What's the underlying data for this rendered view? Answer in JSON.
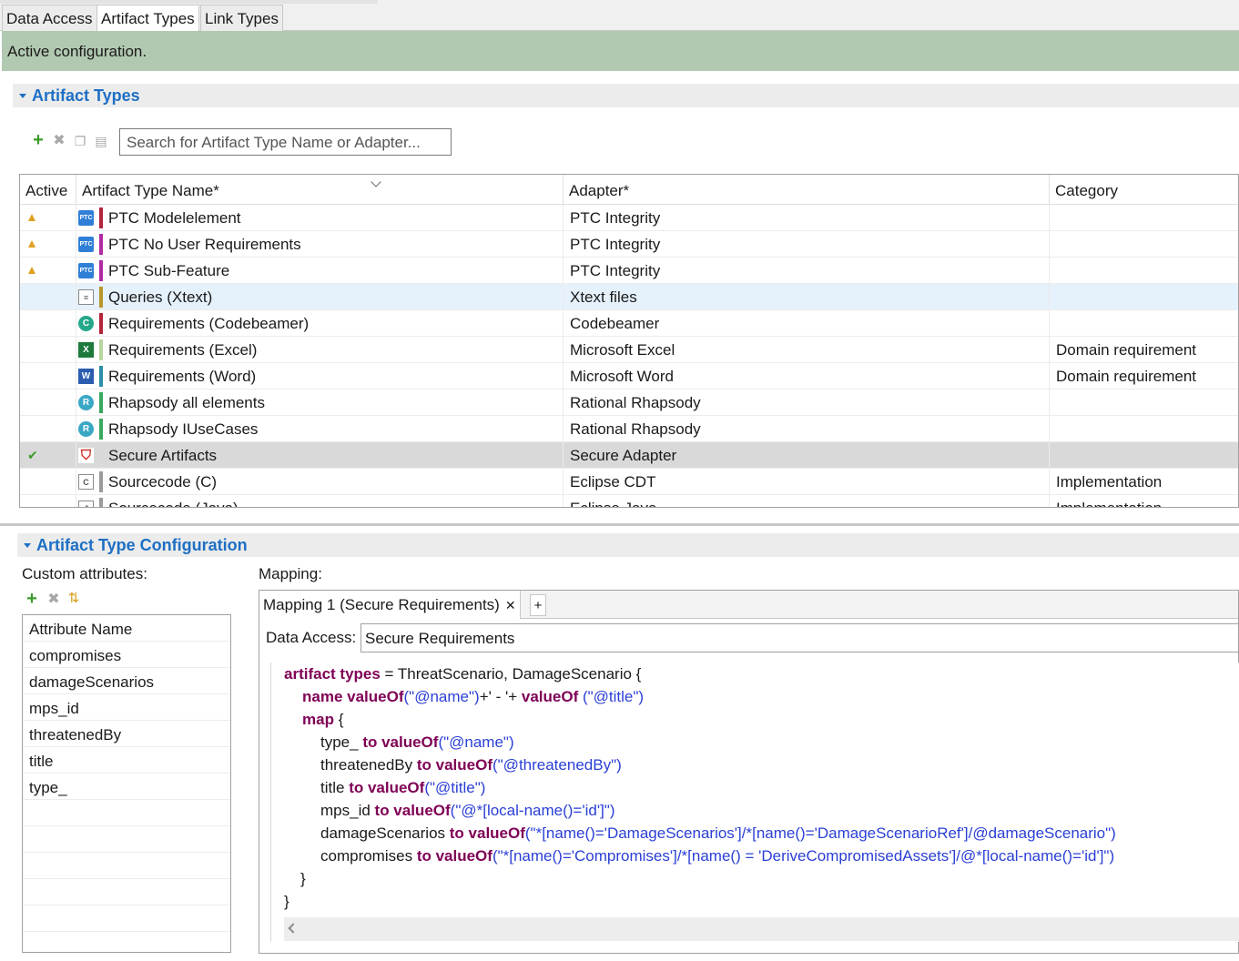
{
  "tabs": [
    {
      "label": "Data Access",
      "active": false
    },
    {
      "label": "Artifact Types",
      "active": true
    },
    {
      "label": "Link Types",
      "active": false
    }
  ],
  "status": {
    "text": "Active configuration."
  },
  "artifact_types_section": {
    "title": "Artifact Types",
    "toolbar": {
      "add_icon": "add-icon",
      "delete_icon": "delete-icon",
      "copy_icon": "copy-icon",
      "paste_icon": "paste-icon"
    },
    "search": {
      "placeholder": "Search for Artifact Type Name or Adapter..."
    },
    "columns": [
      "Active",
      "Artifact Type Name*",
      "Adapter*",
      "Category"
    ],
    "rows": [
      {
        "active": "warning",
        "icon": "ptc-icon",
        "color": "#b3243a",
        "name": "PTC Modelelement",
        "adapter": "PTC Integrity",
        "category": ""
      },
      {
        "active": "warning",
        "icon": "ptc-icon",
        "color": "#b02aa0",
        "name": "PTC No User Requirements",
        "adapter": "PTC Integrity",
        "category": ""
      },
      {
        "active": "warning",
        "icon": "ptc-icon",
        "color": "#b02aa0",
        "name": "PTC Sub-Feature",
        "adapter": "PTC Integrity",
        "category": ""
      },
      {
        "active": "",
        "icon": "xtext-file-icon",
        "color": "#b8952a",
        "name": "Queries (Xtext)",
        "adapter": "Xtext files",
        "category": ""
      },
      {
        "active": "",
        "icon": "codebeamer-icon",
        "color": "#b3243a",
        "name": "Requirements (Codebeamer)",
        "adapter": "Codebeamer",
        "category": ""
      },
      {
        "active": "",
        "icon": "excel-icon",
        "color": "#b9d6a0",
        "name": "Requirements (Excel)",
        "adapter": "Microsoft Excel",
        "category": "Domain requirement"
      },
      {
        "active": "",
        "icon": "word-icon",
        "color": "#2a8fa6",
        "name": "Requirements (Word)",
        "adapter": "Microsoft Word",
        "category": "Domain requirement"
      },
      {
        "active": "",
        "icon": "rhapsody-icon",
        "color": "#3aa860",
        "name": "Rhapsody all elements",
        "adapter": "Rational Rhapsody",
        "category": ""
      },
      {
        "active": "",
        "icon": "rhapsody-icon",
        "color": "#3aa860",
        "name": "Rhapsody IUseCases",
        "adapter": "Rational Rhapsody",
        "category": ""
      },
      {
        "active": "check",
        "icon": "shield-icon",
        "color": "",
        "name": "Secure Artifacts",
        "adapter": "Secure Adapter",
        "category": ""
      },
      {
        "active": "",
        "icon": "c-file-icon",
        "color": "#9a9a9a",
        "name": "Sourcecode (C)",
        "adapter": "Eclipse CDT",
        "category": "Implementation"
      },
      {
        "active": "",
        "icon": "java-file-icon",
        "color": "#9a9a9a",
        "name": "Sourcecode (Java)",
        "adapter": "Eclipse Java",
        "category": "Implementation"
      }
    ]
  },
  "config_section": {
    "title": "Artifact Type Configuration",
    "custom_attributes_label": "Custom attributes:",
    "attr_header": "Attribute Name",
    "attributes": [
      "compromises",
      "damageScenarios",
      "mps_id",
      "threatenedBy",
      "title",
      "type_"
    ],
    "mapping_label": "Mapping:",
    "mapping_tab": "Mapping 1 (Secure Requirements)",
    "mapping_add": "+",
    "data_access_label": "Data Access:",
    "data_access_value": "Secure Requirements",
    "code": {
      "l1_kw": "artifact types",
      "l1_rest": " = ThreatScenario, DamageScenario {",
      "l2_kw1": "name valueOf",
      "l2_s1": "(\"@name\")",
      "l2_mid": "+' - '+ ",
      "l2_kw2": "valueOf",
      "l2_s2": " (\"@title\")",
      "l3_kw": "map",
      "l3_rest": " {",
      "m1_a": "type_ ",
      "m1_s": "(\"@name\")",
      "m2_a": "threatenedBy ",
      "m2_s": "(\"@threatenedBy\")",
      "m3_a": "title ",
      "m3_s": "(\"@title\")",
      "m4_a": "mps_id ",
      "m4_s": "(\"@*[local-name()='id']\")",
      "m5_a": "damageScenarios ",
      "m5_s": "(\"*[name()='DamageScenarios']/*[name()='DamageScenarioRef']/@damageScenario\")",
      "m6_a": "compromises ",
      "m6_s": "(\"*[name()='Compromises']/*[name() = 'DeriveCompromisedAssets']/@*[local-name()='id']\")",
      "to_valueof": "to valueOf",
      "close_inner": "}",
      "close_outer": "}"
    }
  }
}
